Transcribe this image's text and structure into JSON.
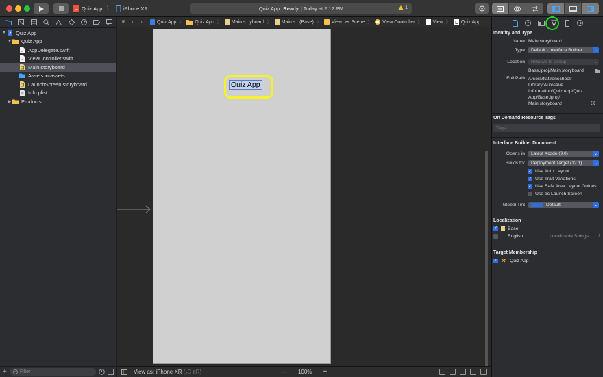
{
  "toolbar": {
    "scheme_name": "Quiz App",
    "device": "iPhone XR",
    "status_app": "Quiz App:",
    "status_state": "Ready",
    "status_time": "| Today at 2:12 PM",
    "warning_count": "1",
    "colors": {
      "red": "#ff5f57",
      "yellow": "#febc2e",
      "green": "#28c840"
    }
  },
  "navigator": {
    "filter_placeholder": "Filter",
    "tree": [
      {
        "label": "Quiz App",
        "icon": "project-icon",
        "indent": 0,
        "expanded": true
      },
      {
        "label": "Quiz App",
        "icon": "folder-icon",
        "indent": 1,
        "expanded": true
      },
      {
        "label": "AppDelegate.swift",
        "icon": "swift-file-icon",
        "indent": 2
      },
      {
        "label": "ViewController.swift",
        "icon": "swift-file-icon",
        "indent": 2
      },
      {
        "label": "Main.storyboard",
        "icon": "storyboard-file-icon",
        "indent": 2,
        "selected": true
      },
      {
        "label": "Assets.xcassets",
        "icon": "assets-folder-icon",
        "indent": 2
      },
      {
        "label": "LaunchScreen.storyboard",
        "icon": "storyboard-file-icon",
        "indent": 2
      },
      {
        "label": "Info.plist",
        "icon": "plist-file-icon",
        "indent": 2
      },
      {
        "label": "Products",
        "icon": "folder-icon",
        "indent": 1,
        "expanded": false
      }
    ]
  },
  "editor": {
    "jumpbar": [
      "Quiz App",
      "Quiz App",
      "Main.s...yboard",
      "Main.s...(Base)",
      "View...er Scene",
      "View Controller",
      "View",
      "Quiz App"
    ],
    "scene_label": "Quiz App",
    "view_as_prefix": "View as: ",
    "view_as_device": "iPhone XR",
    "view_as_suffix": "(ₐC ʀR)",
    "zoom_minus": "—",
    "zoom_level": "100%",
    "zoom_plus": "+"
  },
  "inspector": {
    "identity": {
      "title": "Identity and Type",
      "name_label": "Name",
      "name_value": "Main.storyboard",
      "type_label": "Type",
      "type_value": "Default - Interface Builder...",
      "location_label": "Location",
      "location_value": "Relative to Group",
      "path_value": "Base.lproj/Main.storyboard",
      "full_path_label": "Full Path",
      "full_path_lines": [
        "/Users/flatironschool/",
        "Library/Autosave",
        "Information/Quiz App/Quiz",
        "App/Base.lproj/",
        "Main.storyboard"
      ]
    },
    "on_demand": {
      "title": "On Demand Resource Tags",
      "tags_placeholder": "Tags"
    },
    "ib_document": {
      "title": "Interface Builder Document",
      "opens_in_label": "Opens in",
      "opens_in_value": "Latest Xcode (9.0)",
      "builds_for_label": "Builds for",
      "builds_for_value": "Deployment Target (12.1)",
      "options": [
        {
          "label": "Use Auto Layout",
          "checked": true
        },
        {
          "label": "Use Trait Variations",
          "checked": true
        },
        {
          "label": "Use Safe Area Layout Guides",
          "checked": true
        },
        {
          "label": "Use as Launch Screen",
          "checked": false
        }
      ],
      "global_tint_label": "Global Tint",
      "global_tint_value": "Default",
      "global_tint_color": "#2e6ee0"
    },
    "localization": {
      "title": "Localization",
      "base_label": "Base",
      "english_label": "English",
      "english_value": "Localizable Strings"
    },
    "target_membership": {
      "title": "Target Membership",
      "target_label": "Quiz App"
    }
  }
}
